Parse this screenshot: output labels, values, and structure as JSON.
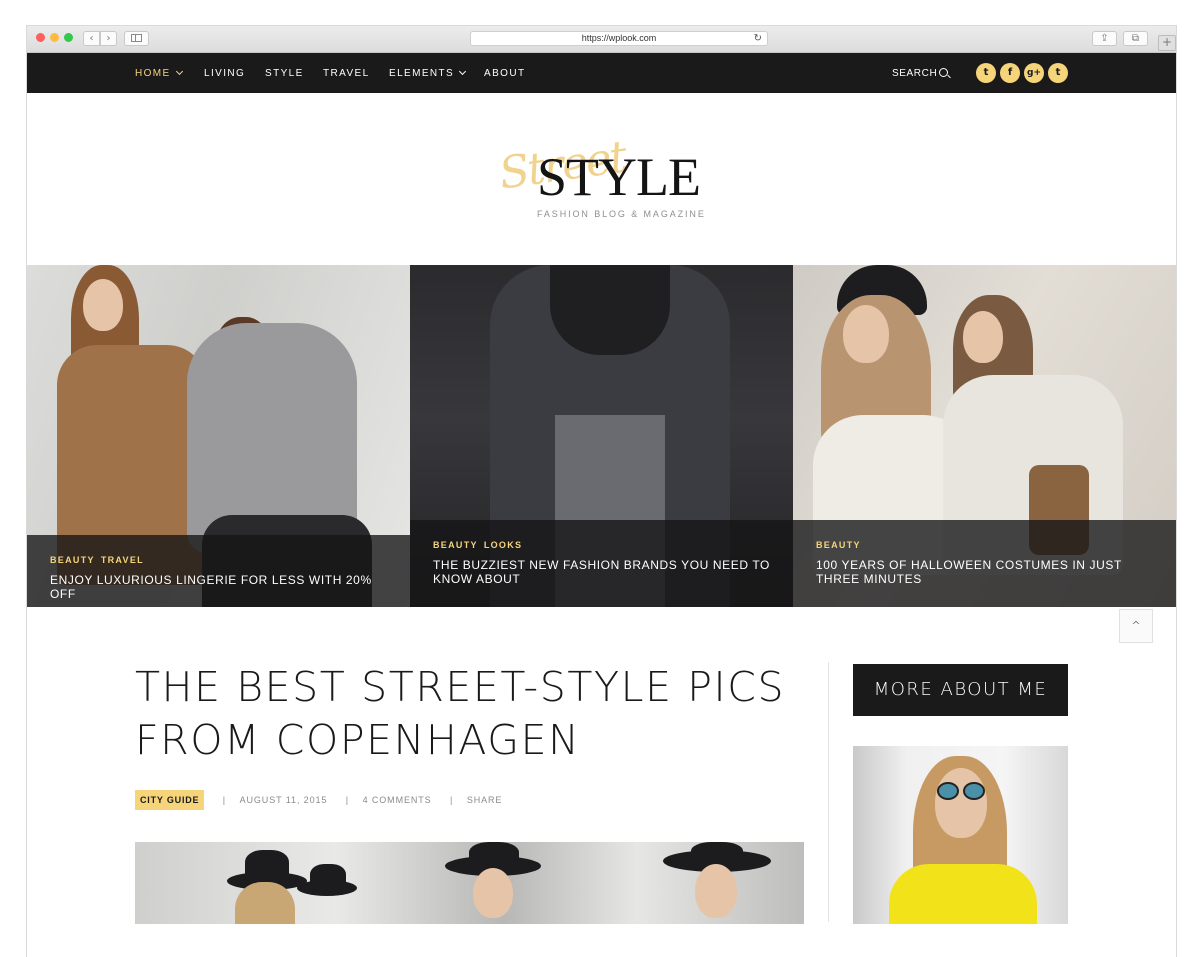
{
  "browser": {
    "url": "https://wplook.com",
    "back_glyph": "‹",
    "forward_glyph": "›",
    "reload_glyph": "↻",
    "share_glyph": "⇪",
    "tabs_glyph": "⧉",
    "plus_glyph": "+"
  },
  "nav": {
    "items": [
      {
        "label": "HOME",
        "active": true,
        "dropdown": true
      },
      {
        "label": "LIVING",
        "active": false,
        "dropdown": false
      },
      {
        "label": "STYLE",
        "active": false,
        "dropdown": false
      },
      {
        "label": "TRAVEL",
        "active": false,
        "dropdown": false
      },
      {
        "label": "ELEMENTS",
        "active": false,
        "dropdown": true
      },
      {
        "label": "ABOUT",
        "active": false,
        "dropdown": false
      }
    ],
    "search_label": "SEARCH",
    "social": [
      {
        "name": "twitter-icon",
        "glyph": "t"
      },
      {
        "name": "facebook-icon",
        "glyph": "f"
      },
      {
        "name": "google-plus-icon",
        "glyph": "g+"
      },
      {
        "name": "tumblr-icon",
        "glyph": "t"
      }
    ]
  },
  "logo": {
    "script": "Street",
    "word": "STYLE",
    "tagline": "FASHION BLOG & MAGAZINE"
  },
  "slider": [
    {
      "categories": [
        "BEAUTY",
        "TRAVEL"
      ],
      "title": "ENJOY LUXURIOUS LINGERIE FOR LESS WITH 20% OFF"
    },
    {
      "categories": [
        "BEAUTY",
        "LOOKS"
      ],
      "title": "THE BUZZIEST NEW FASHION BRANDS YOU NEED TO KNOW ABOUT"
    },
    {
      "categories": [
        "BEAUTY"
      ],
      "title": "100 YEARS OF HALLOWEEN COSTUMES IN JUST THREE MINUTES"
    }
  ],
  "scroll_top_glyph": "^",
  "article": {
    "title_line1": "THE BEST STREET-STYLE PICS",
    "title_line2": "FROM COPENHAGEN",
    "category": "CITY GUIDE",
    "date": "AUGUST 11, 2015",
    "comments": "4 COMMENTS",
    "share": "SHARE",
    "pipe": "|"
  },
  "sidebar": {
    "about_title": "MORE ABOUT ME"
  },
  "colors": {
    "nav_bg": "#1a1a1a",
    "accent": "#f5d47a",
    "text_dark": "#1a1a1a",
    "meta_gray": "#8b8b8b"
  }
}
